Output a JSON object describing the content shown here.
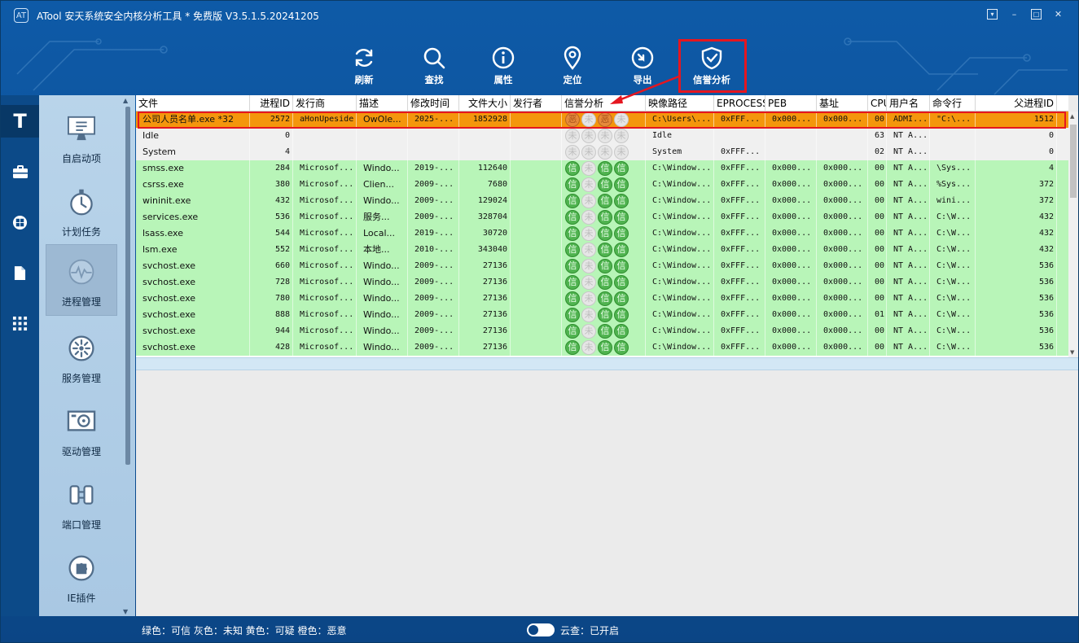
{
  "app": {
    "title": "ATool 安天系统安全内核分析工具 * 免费版 V3.5.1.5.20241205",
    "logo_text": "AT"
  },
  "window_controls": {
    "menu": "▾",
    "minimize": "–",
    "maximize": "□",
    "close": "✕"
  },
  "toolbar": {
    "refresh": "刷新",
    "find": "查找",
    "properties": "属性",
    "locate": "定位",
    "export": "导出",
    "reputation": "信誉分析"
  },
  "rail": {
    "logo": "T"
  },
  "nav": {
    "items": [
      {
        "label": "自启动项",
        "icon": "monitor-icon"
      },
      {
        "label": "计划任务",
        "icon": "stopwatch-icon"
      },
      {
        "label": "进程管理",
        "icon": "activity-icon"
      },
      {
        "label": "服务管理",
        "icon": "cog-icon"
      },
      {
        "label": "驱动管理",
        "icon": "driver-icon"
      },
      {
        "label": "端口管理",
        "icon": "port-icon"
      },
      {
        "label": "IE插件",
        "icon": "plugin-icon"
      }
    ]
  },
  "table": {
    "columns": [
      "文件",
      "进程ID",
      "发行商",
      "描述",
      "修改时间",
      "文件大小",
      "发行者",
      "信誉分析",
      "映像路径",
      "EPROCESS",
      "PEB",
      "基址",
      "CPU",
      "用户名",
      "命令行",
      "父进程ID"
    ],
    "badge_glyphs": {
      "trusted": "信",
      "unknown": "未",
      "malicious": "恶"
    },
    "rows": [
      {
        "status": "malicious",
        "file": "公司人员名单.exe *32",
        "pid": "2572",
        "vendor": "aHonUpeside",
        "desc": "OwOle...",
        "mtime": "2025-...",
        "size": "1852928",
        "publisher": "",
        "rep": [
          "r",
          "u",
          "r",
          "u"
        ],
        "path": "C:\\Users\\...",
        "eprocess": "0xFFF...",
        "peb": "0x000...",
        "base": "0x000...",
        "cpu": "00",
        "user": "ADMI...",
        "cmd": "\"C:\\...",
        "ppid": "1512"
      },
      {
        "status": "unknown",
        "file": "Idle",
        "pid": "0",
        "vendor": "",
        "desc": "",
        "mtime": "",
        "size": "",
        "publisher": "",
        "rep": [
          "u",
          "u",
          "u",
          "u"
        ],
        "path": "Idle",
        "eprocess": "",
        "peb": "",
        "base": "",
        "cpu": "63",
        "user": "NT A...",
        "cmd": "",
        "ppid": "0"
      },
      {
        "status": "unknown",
        "file": "System",
        "pid": "4",
        "vendor": "",
        "desc": "",
        "mtime": "",
        "size": "",
        "publisher": "",
        "rep": [
          "u",
          "u",
          "u",
          "u"
        ],
        "path": "System",
        "eprocess": "0xFFF...",
        "peb": "",
        "base": "",
        "cpu": "02",
        "user": "NT A...",
        "cmd": "",
        "ppid": "0"
      },
      {
        "status": "trusted",
        "file": "smss.exe",
        "pid": "284",
        "vendor": "Microsof...",
        "desc": "Windo...",
        "mtime": "2019-...",
        "size": "112640",
        "publisher": "",
        "rep": [
          "g",
          "u",
          "g",
          "g"
        ],
        "path": "C:\\Window...",
        "eprocess": "0xFFF...",
        "peb": "0x000...",
        "base": "0x000...",
        "cpu": "00",
        "user": "NT A...",
        "cmd": "\\Sys...",
        "ppid": "4"
      },
      {
        "status": "trusted",
        "file": "csrss.exe",
        "pid": "380",
        "vendor": "Microsof...",
        "desc": "Clien...",
        "mtime": "2009-...",
        "size": "7680",
        "publisher": "",
        "rep": [
          "g",
          "u",
          "g",
          "g"
        ],
        "path": "C:\\Window...",
        "eprocess": "0xFFF...",
        "peb": "0x000...",
        "base": "0x000...",
        "cpu": "00",
        "user": "NT A...",
        "cmd": "%Sys...",
        "ppid": "372"
      },
      {
        "status": "trusted",
        "file": "wininit.exe",
        "pid": "432",
        "vendor": "Microsof...",
        "desc": "Windo...",
        "mtime": "2009-...",
        "size": "129024",
        "publisher": "",
        "rep": [
          "g",
          "u",
          "g",
          "g"
        ],
        "path": "C:\\Window...",
        "eprocess": "0xFFF...",
        "peb": "0x000...",
        "base": "0x000...",
        "cpu": "00",
        "user": "NT A...",
        "cmd": "wini...",
        "ppid": "372"
      },
      {
        "status": "trusted",
        "file": "services.exe",
        "pid": "536",
        "vendor": "Microsof...",
        "desc": "服务...",
        "mtime": "2009-...",
        "size": "328704",
        "publisher": "",
        "rep": [
          "g",
          "u",
          "g",
          "g"
        ],
        "path": "C:\\Window...",
        "eprocess": "0xFFF...",
        "peb": "0x000...",
        "base": "0x000...",
        "cpu": "00",
        "user": "NT A...",
        "cmd": "C:\\W...",
        "ppid": "432"
      },
      {
        "status": "trusted",
        "file": "lsass.exe",
        "pid": "544",
        "vendor": "Microsof...",
        "desc": "Local...",
        "mtime": "2019-...",
        "size": "30720",
        "publisher": "",
        "rep": [
          "g",
          "u",
          "g",
          "g"
        ],
        "path": "C:\\Window...",
        "eprocess": "0xFFF...",
        "peb": "0x000...",
        "base": "0x000...",
        "cpu": "00",
        "user": "NT A...",
        "cmd": "C:\\W...",
        "ppid": "432"
      },
      {
        "status": "trusted",
        "file": "lsm.exe",
        "pid": "552",
        "vendor": "Microsof...",
        "desc": "本地...",
        "mtime": "2010-...",
        "size": "343040",
        "publisher": "",
        "rep": [
          "g",
          "u",
          "g",
          "g"
        ],
        "path": "C:\\Window...",
        "eprocess": "0xFFF...",
        "peb": "0x000...",
        "base": "0x000...",
        "cpu": "00",
        "user": "NT A...",
        "cmd": "C:\\W...",
        "ppid": "432"
      },
      {
        "status": "trusted",
        "file": "svchost.exe",
        "pid": "660",
        "vendor": "Microsof...",
        "desc": "Windo...",
        "mtime": "2009-...",
        "size": "27136",
        "publisher": "",
        "rep": [
          "g",
          "u",
          "g",
          "g"
        ],
        "path": "C:\\Window...",
        "eprocess": "0xFFF...",
        "peb": "0x000...",
        "base": "0x000...",
        "cpu": "00",
        "user": "NT A...",
        "cmd": "C:\\W...",
        "ppid": "536"
      },
      {
        "status": "trusted",
        "file": "svchost.exe",
        "pid": "728",
        "vendor": "Microsof...",
        "desc": "Windo...",
        "mtime": "2009-...",
        "size": "27136",
        "publisher": "",
        "rep": [
          "g",
          "u",
          "g",
          "g"
        ],
        "path": "C:\\Window...",
        "eprocess": "0xFFF...",
        "peb": "0x000...",
        "base": "0x000...",
        "cpu": "00",
        "user": "NT A...",
        "cmd": "C:\\W...",
        "ppid": "536"
      },
      {
        "status": "trusted",
        "file": "svchost.exe",
        "pid": "780",
        "vendor": "Microsof...",
        "desc": "Windo...",
        "mtime": "2009-...",
        "size": "27136",
        "publisher": "",
        "rep": [
          "g",
          "u",
          "g",
          "g"
        ],
        "path": "C:\\Window...",
        "eprocess": "0xFFF...",
        "peb": "0x000...",
        "base": "0x000...",
        "cpu": "00",
        "user": "NT A...",
        "cmd": "C:\\W...",
        "ppid": "536"
      },
      {
        "status": "trusted",
        "file": "svchost.exe",
        "pid": "888",
        "vendor": "Microsof...",
        "desc": "Windo...",
        "mtime": "2009-...",
        "size": "27136",
        "publisher": "",
        "rep": [
          "g",
          "u",
          "g",
          "g"
        ],
        "path": "C:\\Window...",
        "eprocess": "0xFFF...",
        "peb": "0x000...",
        "base": "0x000...",
        "cpu": "01",
        "user": "NT A...",
        "cmd": "C:\\W...",
        "ppid": "536"
      },
      {
        "status": "trusted",
        "file": "svchost.exe",
        "pid": "944",
        "vendor": "Microsof...",
        "desc": "Windo...",
        "mtime": "2009-...",
        "size": "27136",
        "publisher": "",
        "rep": [
          "g",
          "u",
          "g",
          "g"
        ],
        "path": "C:\\Window...",
        "eprocess": "0xFFF...",
        "peb": "0x000...",
        "base": "0x000...",
        "cpu": "00",
        "user": "NT A...",
        "cmd": "C:\\W...",
        "ppid": "536"
      },
      {
        "status": "trusted",
        "file": "svchost.exe",
        "pid": "428",
        "vendor": "Microsof...",
        "desc": "Windo...",
        "mtime": "2009-...",
        "size": "27136",
        "publisher": "",
        "rep": [
          "g",
          "u",
          "g",
          "g"
        ],
        "path": "C:\\Window...",
        "eprocess": "0xFFF...",
        "peb": "0x000...",
        "base": "0x000...",
        "cpu": "00",
        "user": "NT A...",
        "cmd": "C:\\W...",
        "ppid": "536"
      }
    ]
  },
  "status": {
    "legend": "绿色：可信 灰色：未知 黄色：可疑 橙色：恶意",
    "cloud": "云查：已开启",
    "cloud_enabled": true
  },
  "colors": {
    "malicious_row": "#f4960c",
    "unknown_row": "#f0f0f0",
    "trusted_row": "#b8f5b8",
    "highlight": "#e5161f"
  }
}
